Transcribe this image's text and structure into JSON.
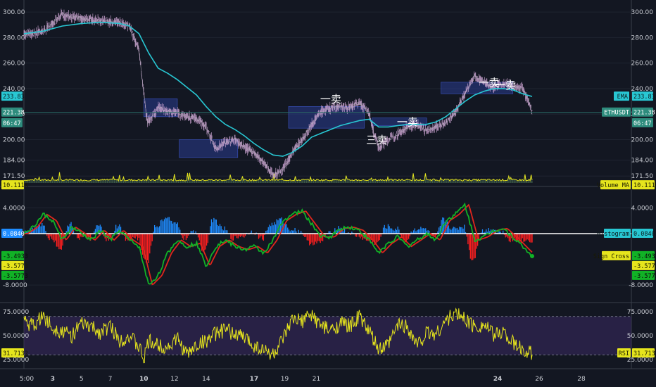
{
  "chart_data": [
    {
      "type": "line",
      "panel": "price",
      "symbol": "ETHUSDT",
      "ylim": [
        165,
        305
      ],
      "y_ticks": [
        "300.00",
        "280.00",
        "260.00",
        "240.00",
        "220.00",
        "200.00",
        "184.00",
        "171.50"
      ],
      "price_path": [
        [
          0,
          282
        ],
        [
          2,
          285
        ],
        [
          4,
          298
        ],
        [
          5,
          296
        ],
        [
          7,
          294
        ],
        [
          8,
          293
        ],
        [
          10,
          292
        ],
        [
          11,
          289
        ],
        [
          12,
          270
        ],
        [
          12.5,
          236
        ],
        [
          12.9,
          213
        ],
        [
          14,
          225
        ],
        [
          15,
          222
        ],
        [
          16,
          221
        ],
        [
          17,
          218
        ],
        [
          18,
          217
        ],
        [
          19,
          210
        ],
        [
          20,
          193
        ],
        [
          21,
          198
        ],
        [
          22,
          200
        ],
        [
          23,
          194
        ],
        [
          24,
          190
        ],
        [
          25,
          182
        ],
        [
          26,
          172
        ],
        [
          27,
          176
        ],
        [
          28,
          190
        ],
        [
          29,
          200
        ],
        [
          30,
          212
        ],
        [
          31,
          222
        ],
        [
          32,
          225
        ],
        [
          33,
          226
        ],
        [
          34,
          225
        ],
        [
          35,
          229
        ],
        [
          36,
          221
        ],
        [
          36.5,
          205
        ],
        [
          37,
          194
        ],
        [
          38,
          200
        ],
        [
          39,
          205
        ],
        [
          40,
          210
        ],
        [
          41,
          212
        ],
        [
          42,
          207
        ],
        [
          43,
          210
        ],
        [
          44,
          213
        ],
        [
          45,
          222
        ],
        [
          46,
          236
        ],
        [
          47,
          250
        ],
        [
          48,
          245
        ],
        [
          49,
          241
        ],
        [
          50,
          244
        ],
        [
          51,
          242
        ],
        [
          52,
          240
        ],
        [
          52.8,
          227
        ],
        [
          53,
          221
        ]
      ],
      "ema": [
        {
          "x": [
            0,
            2,
            4,
            6,
            8,
            10,
            11,
            12,
            13,
            14,
            15,
            16,
            17,
            18,
            19,
            20,
            21,
            22,
            23,
            24,
            25,
            26,
            27,
            28,
            29,
            30,
            31,
            32,
            33,
            34,
            35,
            36,
            37,
            38,
            39,
            40,
            41,
            42,
            43,
            44,
            45,
            46,
            47,
            48,
            49,
            50,
            51,
            52,
            53
          ],
          "y": [
            283,
            285,
            289,
            291,
            292,
            291,
            289,
            283,
            268,
            256,
            252,
            247,
            241,
            235,
            226,
            218,
            212,
            208,
            203,
            197,
            192,
            188,
            187,
            190,
            195,
            202,
            205,
            208,
            211,
            213,
            215,
            216,
            210,
            210,
            211,
            212,
            212,
            212,
            214,
            218,
            224,
            230,
            235,
            238,
            240,
            240,
            239,
            236,
            233.83
          ]
        }
      ],
      "boxes": [
        {
          "x0": 12.5,
          "x1": 16,
          "y0": 218,
          "y1": 232
        },
        {
          "x0": 16.2,
          "x1": 22.3,
          "y0": 186,
          "y1": 200
        },
        {
          "x0": 27.6,
          "x1": 35.5,
          "y0": 209,
          "y1": 226
        },
        {
          "x0": 36.3,
          "x1": 42,
          "y0": 211,
          "y1": 217
        },
        {
          "x0": 43.5,
          "x1": 51,
          "y0": 236,
          "y1": 245
        }
      ],
      "annotations": [
        {
          "text": "一卖",
          "x": 32,
          "y": 229
        },
        {
          "text": "三卖",
          "x": 36.8,
          "y": 197
        },
        {
          "text": "一卖",
          "x": 40,
          "y": 211
        },
        {
          "text": "一卖",
          "x": 48.5,
          "y": 242
        },
        {
          "text": "一卖",
          "x": 50.2,
          "y": 240
        }
      ],
      "labels": {
        "ema_name": "EMA",
        "ema_value": "233.83",
        "price_value": "221.38",
        "timer": "06:47",
        "volume_name": "Volume MA",
        "volume_value": "10.111K"
      },
      "colors": {
        "price": "#d2a7d7",
        "ema": "#28c7d3",
        "volume_ma": "#e6e51d",
        "box": "#2a3d8f"
      }
    },
    {
      "type": "line",
      "panel": "macd",
      "ylim": [
        -10.5,
        7
      ],
      "y_ticks": [
        "4.0000",
        "-8.0000"
      ],
      "labels": {
        "histogram_name": "Histogram",
        "histogram_value": "0.0840",
        "signal_name": "Sign Cross",
        "macd_value": "-3.4933",
        "signal_value": "-3.5773",
        "signal_value2": "-3.5773"
      },
      "path": [
        [
          0,
          0
        ],
        [
          1,
          1
        ],
        [
          2,
          3
        ],
        [
          3,
          2
        ],
        [
          4,
          -1
        ],
        [
          5,
          1
        ],
        [
          6,
          0
        ],
        [
          7,
          -1
        ],
        [
          8,
          0.5
        ],
        [
          9,
          -1
        ],
        [
          10,
          0.5
        ],
        [
          11,
          -1
        ],
        [
          12,
          -2
        ],
        [
          13,
          -8
        ],
        [
          14,
          -6.5
        ],
        [
          15,
          -3
        ],
        [
          16,
          -1
        ],
        [
          17,
          -2
        ],
        [
          18,
          -1.5
        ],
        [
          19,
          -5
        ],
        [
          20,
          -2
        ],
        [
          21,
          -1
        ],
        [
          22,
          -2
        ],
        [
          23,
          -2.5
        ],
        [
          24,
          -2
        ],
        [
          25,
          -3
        ],
        [
          26,
          -1
        ],
        [
          27,
          2
        ],
        [
          28,
          3
        ],
        [
          29,
          3.5
        ],
        [
          30,
          1.5
        ],
        [
          31,
          -0.5
        ],
        [
          32,
          -0.5
        ],
        [
          33,
          0.8
        ],
        [
          34,
          1
        ],
        [
          35,
          0.5
        ],
        [
          36,
          -1
        ],
        [
          37,
          -3
        ],
        [
          38,
          -1.5
        ],
        [
          39,
          -0.5
        ],
        [
          40,
          -2
        ],
        [
          41,
          -1
        ],
        [
          42,
          0
        ],
        [
          43,
          -1
        ],
        [
          44,
          2
        ],
        [
          45,
          3
        ],
        [
          46,
          4.5
        ],
        [
          47,
          -1
        ],
        [
          48,
          -0.5
        ],
        [
          49,
          0.5
        ],
        [
          50,
          0.8
        ],
        [
          51,
          -0.5
        ],
        [
          52,
          -2
        ],
        [
          53,
          -3.5
        ]
      ],
      "colors": {
        "macd": "#11b226",
        "signal": "#e0261d",
        "hist_pos": "#1e8cff",
        "hist_neg": "#ff1f1f",
        "zero": "#ffffff"
      }
    },
    {
      "type": "line",
      "panel": "rsi",
      "ylim": [
        17,
        83
      ],
      "y_ticks": [
        "75.0000",
        "50.0000",
        "25.0000"
      ],
      "bands": [
        30,
        70
      ],
      "labels": {
        "rsi_name": "RSI",
        "rsi_value": "31.7132"
      },
      "path": [
        [
          0,
          65
        ],
        [
          1,
          60
        ],
        [
          2,
          71
        ],
        [
          3,
          58
        ],
        [
          4,
          55
        ],
        [
          5,
          50
        ],
        [
          6,
          62
        ],
        [
          7,
          59
        ],
        [
          8,
          53
        ],
        [
          9,
          60
        ],
        [
          10,
          45
        ],
        [
          11,
          50
        ],
        [
          12,
          38
        ],
        [
          12.5,
          25
        ],
        [
          13,
          44
        ],
        [
          14,
          40
        ],
        [
          15,
          38
        ],
        [
          16,
          47
        ],
        [
          17,
          30
        ],
        [
          18,
          40
        ],
        [
          19,
          45
        ],
        [
          20,
          52
        ],
        [
          21,
          56
        ],
        [
          22,
          52
        ],
        [
          23,
          48
        ],
        [
          24,
          40
        ],
        [
          25,
          35
        ],
        [
          26,
          30
        ],
        [
          27,
          45
        ],
        [
          28,
          66
        ],
        [
          29,
          65
        ],
        [
          30,
          72
        ],
        [
          31,
          60
        ],
        [
          32,
          55
        ],
        [
          33,
          63
        ],
        [
          34,
          60
        ],
        [
          35,
          70
        ],
        [
          36,
          54
        ],
        [
          37,
          35
        ],
        [
          38,
          40
        ],
        [
          39,
          62
        ],
        [
          40,
          60
        ],
        [
          41,
          40
        ],
        [
          42,
          53
        ],
        [
          43,
          52
        ],
        [
          44,
          66
        ],
        [
          45,
          73
        ],
        [
          46,
          68
        ],
        [
          47,
          59
        ],
        [
          48,
          62
        ],
        [
          49,
          50
        ],
        [
          50,
          55
        ],
        [
          51,
          42
        ],
        [
          52,
          35
        ],
        [
          53,
          31.7
        ]
      ],
      "colors": {
        "line": "#e6e51d",
        "band": "#3b2963"
      }
    }
  ],
  "x_axis": {
    "ticks": [
      {
        "x": 0,
        "label": "5:00"
      },
      {
        "x": 3,
        "label": "3",
        "bold": true
      },
      {
        "x": 6,
        "label": "5"
      },
      {
        "x": 9,
        "label": "7"
      },
      {
        "x": 12.5,
        "label": "10",
        "bold": true
      },
      {
        "x": 15.7,
        "label": "12"
      },
      {
        "x": 19,
        "label": "14"
      },
      {
        "x": 24,
        "label": "17",
        "bold": true
      },
      {
        "x": 27.2,
        "label": "19"
      },
      {
        "x": 30.5,
        "label": "21"
      },
      {
        "x": 35,
        "label": "24",
        "bold": true
      },
      {
        "x": 38.4,
        "label": "26"
      },
      {
        "x": 42,
        "label": "28"
      }
    ]
  }
}
